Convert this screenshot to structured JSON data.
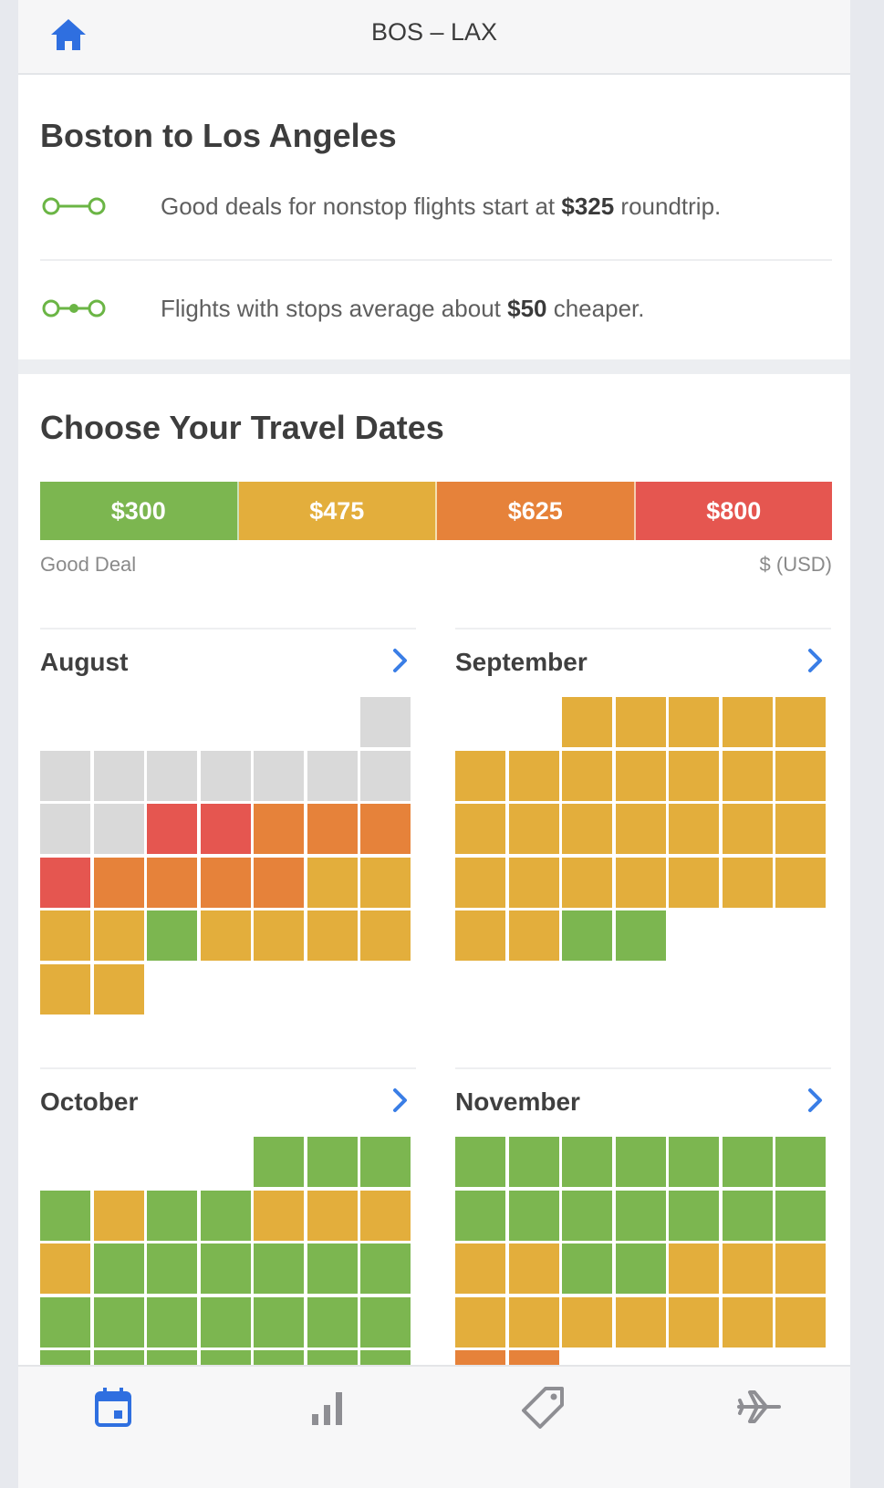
{
  "header": {
    "title": "BOS – LAX",
    "home_icon": "home-icon"
  },
  "route": {
    "title": "Boston to Los Angeles",
    "nonstop": {
      "icon": "nonstop-route-icon",
      "pre": "Good deals for nonstop flights start at ",
      "price": "$325",
      "post": " roundtrip."
    },
    "stops": {
      "icon": "connecting-route-icon",
      "pre": "Flights with stops average about ",
      "price": "$50",
      "post": " cheaper."
    }
  },
  "dates": {
    "title": "Choose Your Travel Dates",
    "legend": [
      {
        "label": "$300",
        "color": "#7cb650",
        "level": "g"
      },
      {
        "label": "$475",
        "color": "#e3ae3c",
        "level": "y"
      },
      {
        "label": "$625",
        "color": "#e6823a",
        "level": "o"
      },
      {
        "label": "$800",
        "color": "#e55650",
        "level": "r"
      }
    ],
    "legend_left": "Good Deal",
    "legend_right": "$ (USD)"
  },
  "colors": {
    "g": "#7cb650",
    "y": "#e3ae3c",
    "o": "#e6823a",
    "r": "#e55650",
    "x": "#d9d9d9"
  },
  "months": [
    {
      "name": "August",
      "weeks": [
        [
          "-",
          "-",
          "-",
          "-",
          "-",
          "-",
          "x"
        ],
        [
          "x",
          "x",
          "x",
          "x",
          "x",
          "x",
          "x"
        ],
        [
          "x",
          "x",
          "r",
          "r",
          "o",
          "o",
          "o"
        ],
        [
          "r",
          "o",
          "o",
          "o",
          "o",
          "y",
          "y"
        ],
        [
          "y",
          "y",
          "g",
          "y",
          "y",
          "y",
          "y"
        ],
        [
          "y",
          "y",
          "-",
          "-",
          "-",
          "-",
          "-"
        ]
      ]
    },
    {
      "name": "September",
      "weeks": [
        [
          "-",
          "-",
          "y",
          "y",
          "y",
          "y",
          "y"
        ],
        [
          "y",
          "y",
          "y",
          "y",
          "y",
          "y",
          "y"
        ],
        [
          "y",
          "y",
          "y",
          "y",
          "y",
          "y",
          "y"
        ],
        [
          "y",
          "y",
          "y",
          "y",
          "y",
          "y",
          "y"
        ],
        [
          "y",
          "y",
          "g",
          "g",
          "-",
          "-",
          "-"
        ]
      ]
    },
    {
      "name": "October",
      "weeks": [
        [
          "-",
          "-",
          "-",
          "-",
          "g",
          "g",
          "g"
        ],
        [
          "g",
          "y",
          "g",
          "g",
          "y",
          "y",
          "y"
        ],
        [
          "y",
          "g",
          "g",
          "g",
          "g",
          "g",
          "g"
        ],
        [
          "g",
          "g",
          "g",
          "g",
          "g",
          "g",
          "g"
        ],
        [
          "g",
          "g",
          "g",
          "g",
          "g",
          "g",
          "g"
        ]
      ]
    },
    {
      "name": "November",
      "weeks": [
        [
          "g",
          "g",
          "g",
          "g",
          "g",
          "g",
          "g"
        ],
        [
          "g",
          "g",
          "g",
          "g",
          "g",
          "g",
          "g"
        ],
        [
          "y",
          "y",
          "g",
          "g",
          "y",
          "y",
          "y"
        ],
        [
          "y",
          "y",
          "y",
          "y",
          "y",
          "y",
          "y"
        ],
        [
          "o",
          "o",
          "-",
          "-",
          "-",
          "-",
          "-"
        ]
      ]
    }
  ],
  "tabs": [
    {
      "name": "tab-calendar",
      "icon": "calendar-icon",
      "active": true
    },
    {
      "name": "tab-price-chart",
      "icon": "bar-chart-icon",
      "active": false
    },
    {
      "name": "tab-deals",
      "icon": "tag-icon",
      "active": false
    },
    {
      "name": "tab-flights",
      "icon": "airplane-icon",
      "active": false
    }
  ]
}
